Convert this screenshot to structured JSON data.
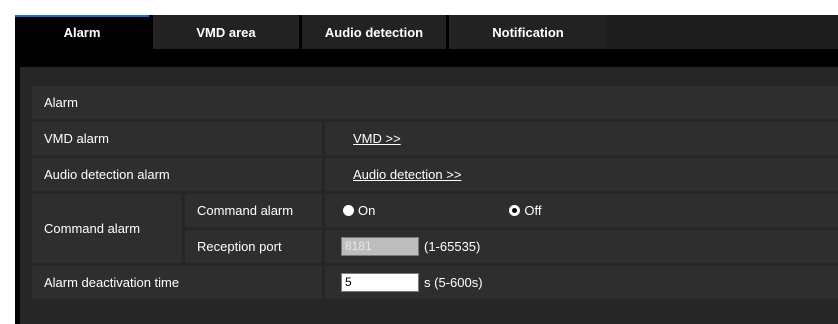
{
  "tabs": [
    {
      "label": "Alarm",
      "active": true
    },
    {
      "label": "VMD area",
      "active": false
    },
    {
      "label": "Audio detection",
      "active": false
    },
    {
      "label": "Notification",
      "active": false
    }
  ],
  "section": {
    "title": "Alarm"
  },
  "rows": {
    "vmd_alarm": {
      "label": "VMD alarm",
      "link": "VMD >>"
    },
    "audio_detection_alarm": {
      "label": "Audio detection alarm",
      "link": "Audio detection >>"
    },
    "command_alarm": {
      "label": "Command alarm",
      "command_alarm_label": "Command alarm",
      "on_label": "On",
      "off_label": "Off",
      "selected": "Off",
      "reception_port_label": "Reception port",
      "reception_port_value": "8181",
      "reception_port_range": "(1-65535)"
    },
    "alarm_deactivation_time": {
      "label": "Alarm deactivation time",
      "value": "5",
      "unit_range": "s (5-600s)"
    }
  },
  "colors": {
    "background": "#000000",
    "row": "#2e2e2e",
    "active_tab_accent": "#1e6ec8"
  }
}
